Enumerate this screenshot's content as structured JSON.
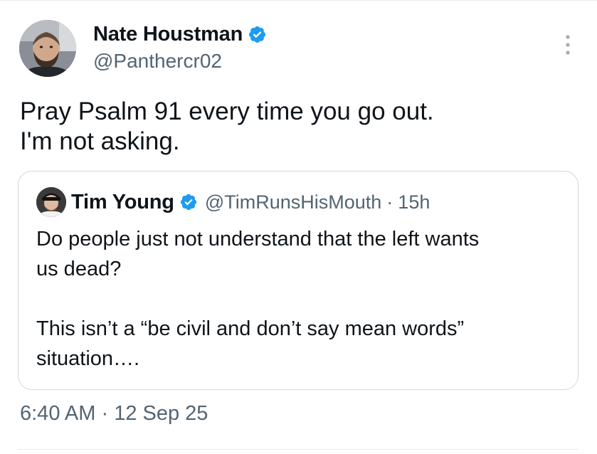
{
  "tweet": {
    "author": {
      "display_name": "Nate Houstman",
      "handle": "@Panthercr02",
      "verified": true,
      "avatar_icon": "bearded-man-avatar"
    },
    "text_lines": [
      "Pray Psalm 91 every time you go out.",
      "I'm not asking."
    ],
    "more_icon": "vertical-ellipsis-icon",
    "timestamp": {
      "time": "6:40 AM",
      "separator": "·",
      "date": "12 Sep 25"
    }
  },
  "quoted_tweet": {
    "author": {
      "display_name": "Tim Young",
      "handle": "@TimRunsHisMouth",
      "verified": true,
      "avatar_icon": "man-in-cap-avatar"
    },
    "separator": "·",
    "age": "15h",
    "paragraphs": [
      [
        "Do people just not understand that the left wants",
        "us dead?"
      ],
      [
        "This isn’t a “be civil and don’t say mean words”",
        "situation…."
      ]
    ]
  },
  "colors": {
    "text_primary": "#0f1419",
    "text_secondary": "#536471",
    "verified_blue": "#1d9bf0",
    "border": "#cfd9de"
  }
}
